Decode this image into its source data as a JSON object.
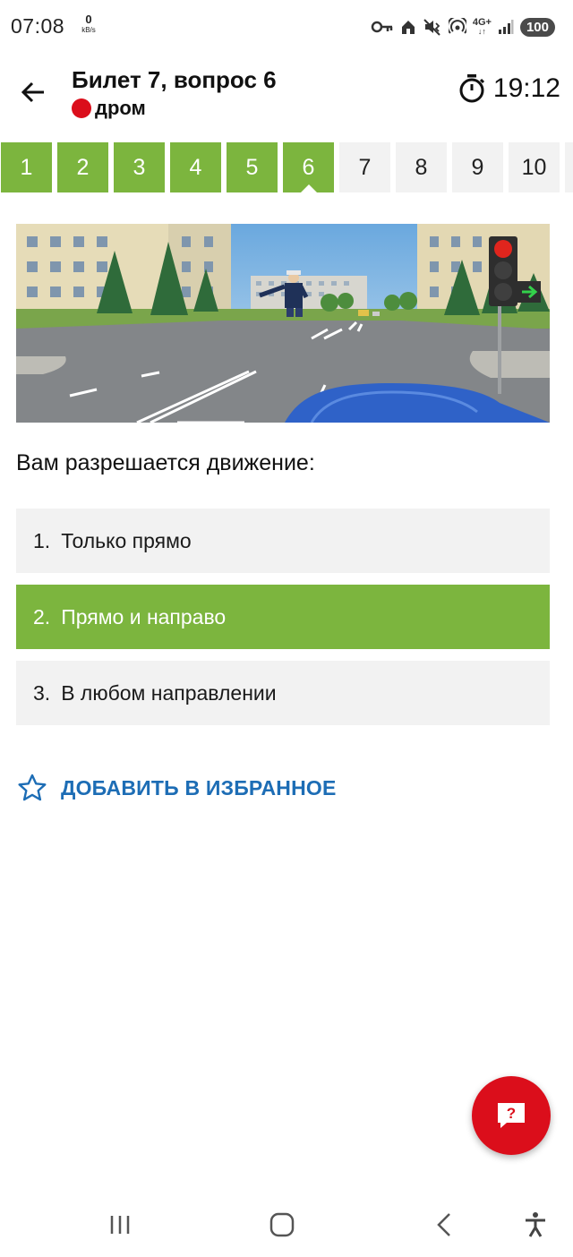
{
  "status_bar": {
    "time": "07:08",
    "net_speed_value": "0",
    "net_speed_unit": "kB/s",
    "network": "4G+",
    "battery": "100",
    "icons": [
      "key-icon",
      "home-icon",
      "mute-vibrate-icon",
      "hotspot-icon",
      "signal-icon"
    ]
  },
  "header": {
    "title": "Билет 7, вопрос 6",
    "brand": "дром",
    "timer": "19:12"
  },
  "tabs": {
    "items": [
      {
        "label": "1",
        "state": "done"
      },
      {
        "label": "2",
        "state": "done"
      },
      {
        "label": "3",
        "state": "done"
      },
      {
        "label": "4",
        "state": "done"
      },
      {
        "label": "5",
        "state": "done"
      },
      {
        "label": "6",
        "state": "current"
      },
      {
        "label": "7",
        "state": "todo"
      },
      {
        "label": "8",
        "state": "todo"
      },
      {
        "label": "9",
        "state": "todo"
      },
      {
        "label": "10",
        "state": "todo"
      }
    ]
  },
  "question": {
    "text": "Вам разрешается движение:",
    "answers": [
      {
        "number": "1.",
        "text": "Только прямо",
        "selected": false
      },
      {
        "number": "2.",
        "text": "Прямо и направо",
        "selected": true
      },
      {
        "number": "3.",
        "text": "В любом направлении",
        "selected": false
      }
    ]
  },
  "favorite": {
    "label": "ДОБАВИТЬ В ИЗБРАННОЕ"
  },
  "help_button": {
    "label": "?"
  },
  "colors": {
    "accent_green": "#7cb53e",
    "brand_red": "#db0e1b",
    "link_blue": "#1d6db5",
    "tab_inactive": "#f2f2f2"
  }
}
